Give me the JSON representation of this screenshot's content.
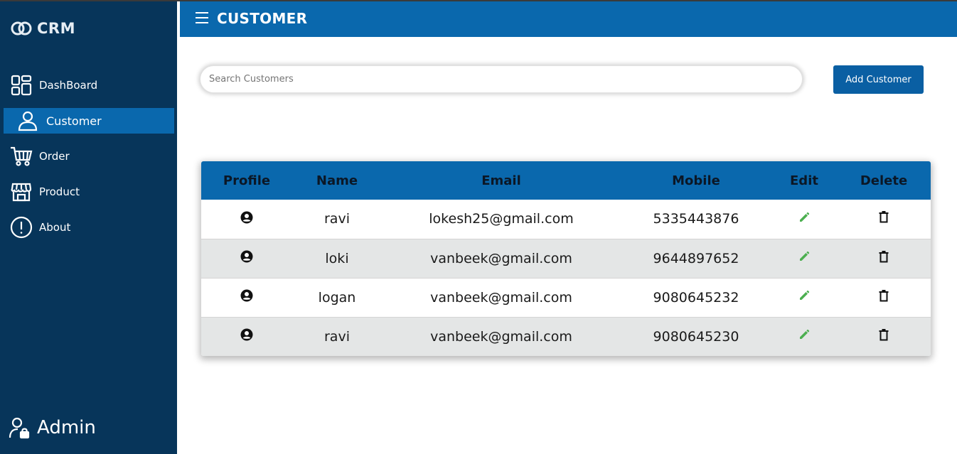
{
  "app": {
    "brand": "CRM"
  },
  "sidebar": {
    "items": [
      {
        "label": "DashBoard",
        "icon": "dashboard-icon",
        "active": false
      },
      {
        "label": "Customer",
        "icon": "user-icon",
        "active": true
      },
      {
        "label": "Order",
        "icon": "cart-icon",
        "active": false
      },
      {
        "label": "Product",
        "icon": "store-icon",
        "active": false
      },
      {
        "label": "About",
        "icon": "info-icon",
        "active": false
      }
    ],
    "footer": {
      "label": "Admin",
      "icon": "admin-lock-icon"
    }
  },
  "header": {
    "title": "CUSTOMER",
    "menu_icon": "hamburger-icon"
  },
  "search": {
    "placeholder": "Search Customers",
    "value": ""
  },
  "actions": {
    "add_label": "Add Customer"
  },
  "table": {
    "columns": [
      "Profile",
      "Name",
      "Email",
      "Mobile",
      "Edit",
      "Delete"
    ],
    "rows": [
      {
        "name": "ravi",
        "email": "lokesh25@gmail.com",
        "mobile": "5335443876"
      },
      {
        "name": "loki",
        "email": "vanbeek@gmail.com",
        "mobile": "9644897652"
      },
      {
        "name": "logan",
        "email": "vanbeek@gmail.com",
        "mobile": "9080645232"
      },
      {
        "name": "ravi",
        "email": "vanbeek@gmail.com",
        "mobile": "9080645230"
      }
    ]
  },
  "colors": {
    "sidebar_bg": "#07355a",
    "accent": "#0a68ad",
    "button_bg": "#0a5fa3",
    "edit_icon": "#4caf50",
    "row_alt": "#e4e6e6"
  }
}
